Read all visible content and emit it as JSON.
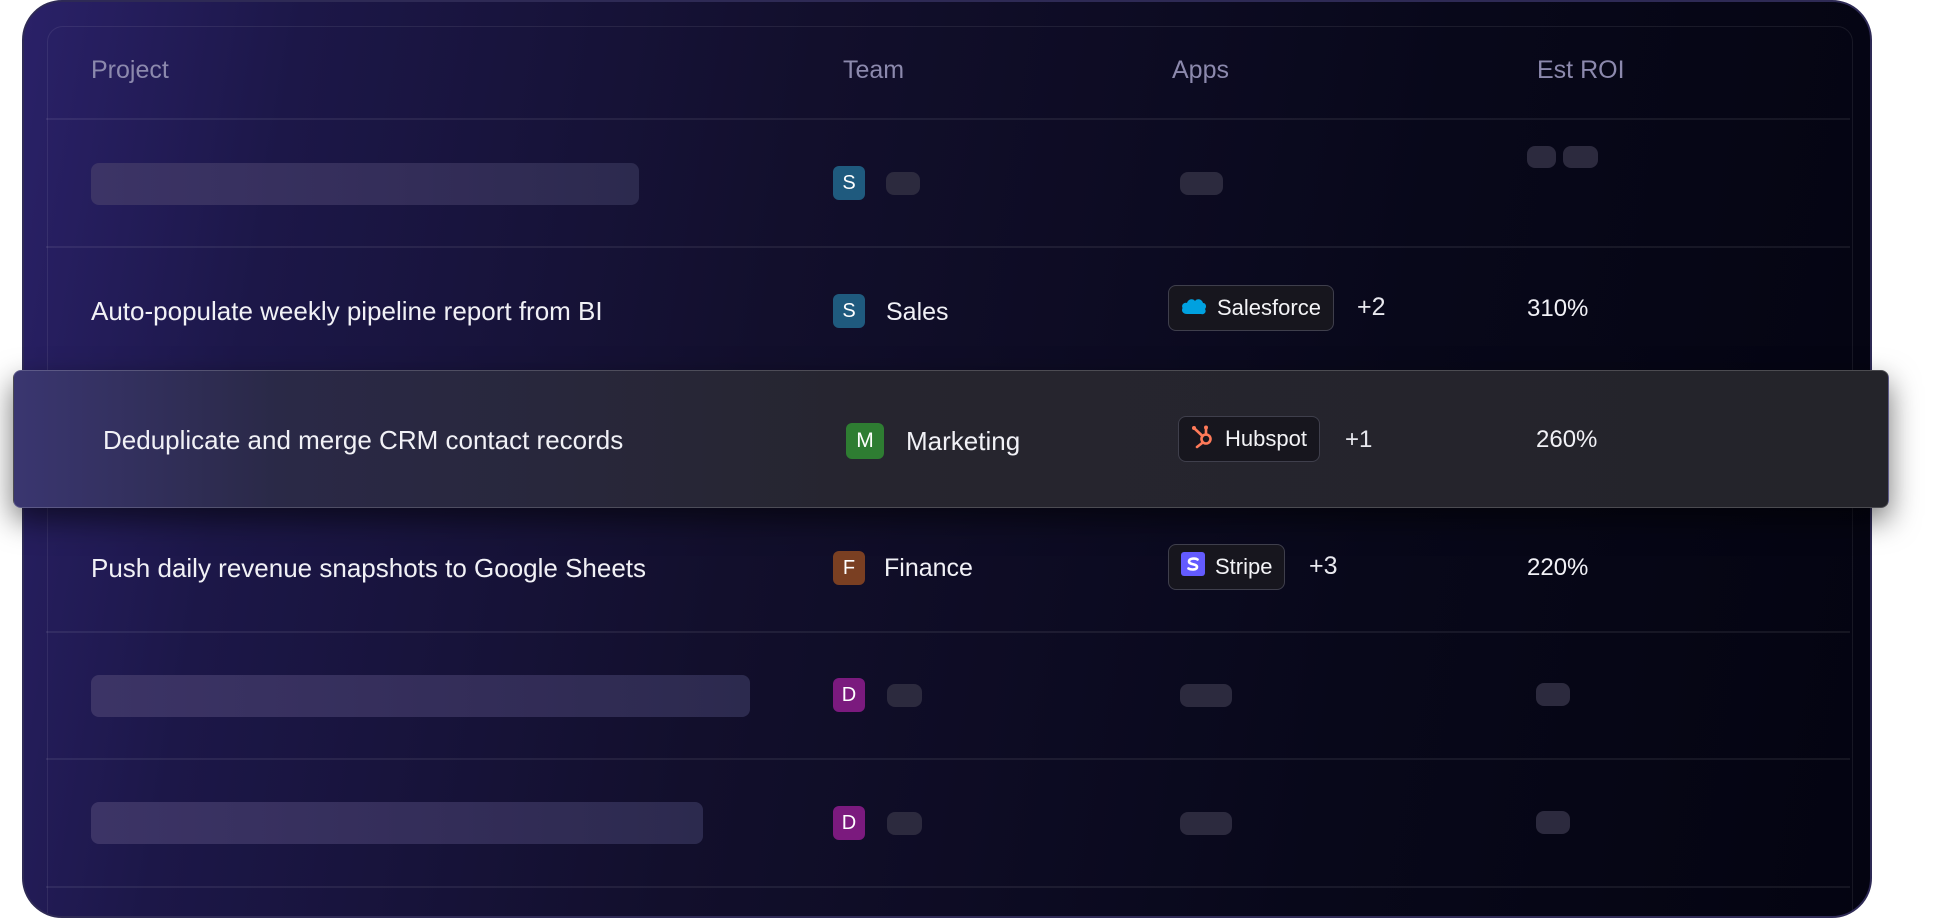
{
  "table": {
    "columns": {
      "project": "Project",
      "team": "Team",
      "apps": "Apps",
      "roi": "Est ROI"
    },
    "rows": [
      {
        "avatar_letter": "S",
        "avatar_color": "#1f5a7e"
      },
      {
        "project": "Auto-populate weekly pipeline report from BI",
        "avatar_letter": "S",
        "avatar_color": "#1f5a7e",
        "team": "Sales",
        "app": "Salesforce",
        "app_icon": "salesforce-cloud-icon",
        "more": "+2",
        "roi": "310%"
      },
      {
        "project": "Deduplicate and merge CRM contact records",
        "avatar_letter": "M",
        "avatar_color": "#2e7d32",
        "team": "Marketing",
        "app": "Hubspot",
        "app_icon": "hubspot-icon",
        "more": "+1",
        "roi": "260%"
      },
      {
        "project": "Push daily revenue snapshots to Google Sheets",
        "avatar_letter": "F",
        "avatar_color": "#7a3f22",
        "team": "Finance",
        "app": "Stripe",
        "app_icon": "stripe-s-icon",
        "more": "+3",
        "roi": "220%"
      },
      {
        "avatar_letter": "D",
        "avatar_color": "#7b1a7e"
      },
      {
        "avatar_letter": "D",
        "avatar_color": "#7b1a7e"
      }
    ]
  },
  "colors": {
    "salesforce_blue": "#00a1e0",
    "hubspot_orange": "#ff7a59",
    "stripe_purple": "#635bff"
  }
}
